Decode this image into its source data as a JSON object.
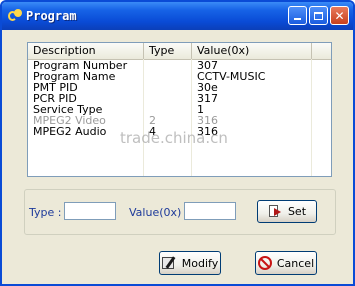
{
  "window": {
    "title": "Program"
  },
  "table": {
    "headers": [
      "Description",
      "Type",
      "Value(0x)"
    ],
    "rows": [
      [
        "Program Number",
        "",
        "307"
      ],
      [
        "Program Name",
        "",
        "CCTV-MUSIC"
      ],
      [
        "PMT PID",
        "",
        "30e"
      ],
      [
        "PCR PID",
        "",
        "317"
      ],
      [
        "Service Type",
        "",
        "1"
      ],
      [
        "MPEG2 Video",
        "2",
        "316"
      ],
      [
        "MPEG2 Audio",
        "4",
        "316"
      ]
    ]
  },
  "watermark": "trade.china.cn",
  "form": {
    "type_label": "Type :",
    "type_value": "",
    "value_label": "Value(0x) :",
    "value_value": ""
  },
  "buttons": {
    "set": "Set",
    "modify": "Modify",
    "cancel": "Cancel"
  },
  "icons": {
    "app": "program-app-icon",
    "set": "set-arrow-icon",
    "modify": "modify-pencil-icon",
    "cancel": "cancel-circle-icon"
  }
}
